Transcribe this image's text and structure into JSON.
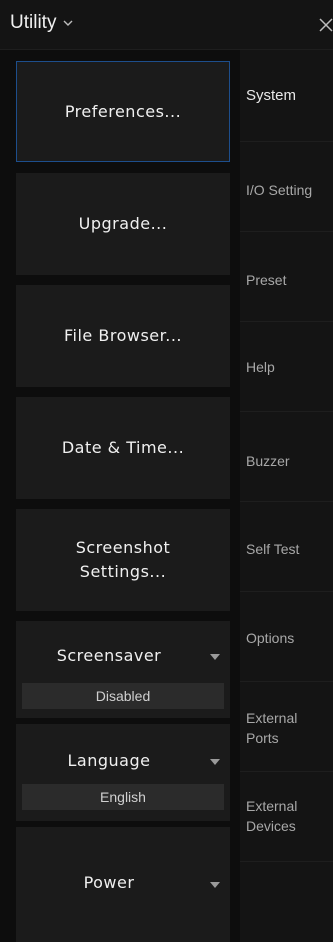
{
  "header": {
    "title": "Utility",
    "title_icon": "chevron-down-icon",
    "close_icon": "close-icon"
  },
  "buttons": {
    "preferences": "Preferences...",
    "upgrade": "Upgrade...",
    "file_browser": "File Browser...",
    "date_time": "Date & Time...",
    "screenshot_line1": "Screenshot",
    "screenshot_line2": "Settings..."
  },
  "dropdowns": {
    "screensaver": {
      "label": "Screensaver",
      "value": "Disabled"
    },
    "language": {
      "label": "Language",
      "value": "English"
    },
    "power": {
      "label": "Power"
    }
  },
  "tabs": {
    "system": "System",
    "io_setting": "I/O Setting",
    "preset": "Preset",
    "help": "Help",
    "buzzer": "Buzzer",
    "self_test": "Self Test",
    "options": "Options",
    "external_ports_1": "External",
    "external_ports_2": "Ports",
    "external_devices_1": "External",
    "external_devices_2": "Devices"
  },
  "colors": {
    "background": "#0d0d0d",
    "panel": "#1b1b1b",
    "selected_border": "#1d4e8c",
    "tab_text": "#a8a8a8"
  }
}
